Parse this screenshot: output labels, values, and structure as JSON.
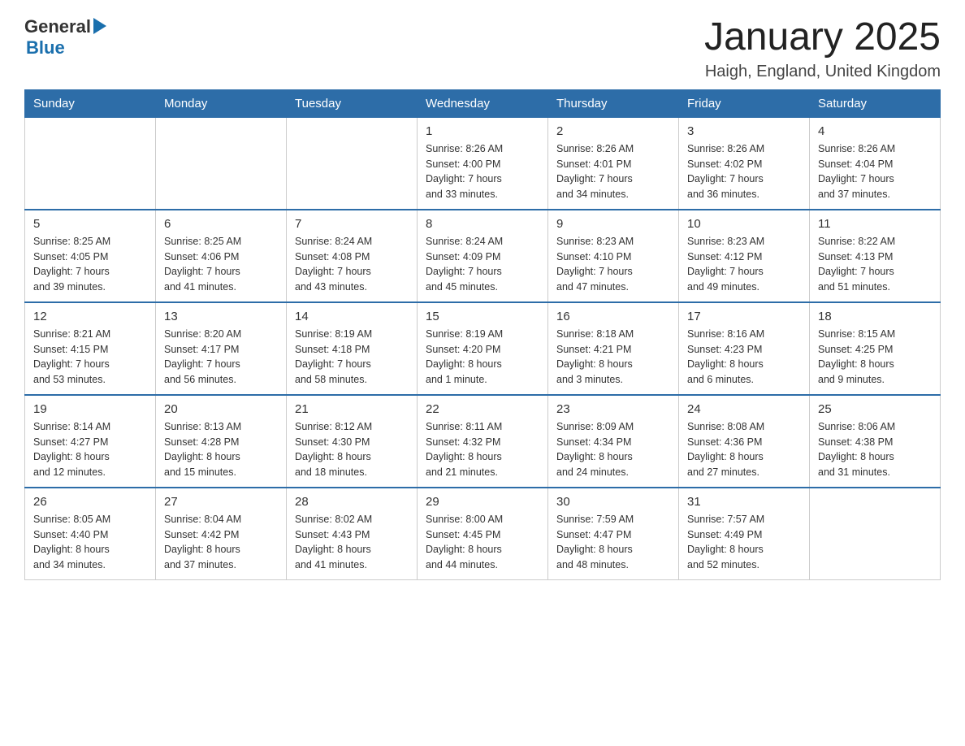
{
  "header": {
    "logo_general": "General",
    "logo_blue": "Blue",
    "month_title": "January 2025",
    "location": "Haigh, England, United Kingdom"
  },
  "days_of_week": [
    "Sunday",
    "Monday",
    "Tuesday",
    "Wednesday",
    "Thursday",
    "Friday",
    "Saturday"
  ],
  "weeks": [
    [
      {
        "day": "",
        "info": ""
      },
      {
        "day": "",
        "info": ""
      },
      {
        "day": "",
        "info": ""
      },
      {
        "day": "1",
        "info": "Sunrise: 8:26 AM\nSunset: 4:00 PM\nDaylight: 7 hours\nand 33 minutes."
      },
      {
        "day": "2",
        "info": "Sunrise: 8:26 AM\nSunset: 4:01 PM\nDaylight: 7 hours\nand 34 minutes."
      },
      {
        "day": "3",
        "info": "Sunrise: 8:26 AM\nSunset: 4:02 PM\nDaylight: 7 hours\nand 36 minutes."
      },
      {
        "day": "4",
        "info": "Sunrise: 8:26 AM\nSunset: 4:04 PM\nDaylight: 7 hours\nand 37 minutes."
      }
    ],
    [
      {
        "day": "5",
        "info": "Sunrise: 8:25 AM\nSunset: 4:05 PM\nDaylight: 7 hours\nand 39 minutes."
      },
      {
        "day": "6",
        "info": "Sunrise: 8:25 AM\nSunset: 4:06 PM\nDaylight: 7 hours\nand 41 minutes."
      },
      {
        "day": "7",
        "info": "Sunrise: 8:24 AM\nSunset: 4:08 PM\nDaylight: 7 hours\nand 43 minutes."
      },
      {
        "day": "8",
        "info": "Sunrise: 8:24 AM\nSunset: 4:09 PM\nDaylight: 7 hours\nand 45 minutes."
      },
      {
        "day": "9",
        "info": "Sunrise: 8:23 AM\nSunset: 4:10 PM\nDaylight: 7 hours\nand 47 minutes."
      },
      {
        "day": "10",
        "info": "Sunrise: 8:23 AM\nSunset: 4:12 PM\nDaylight: 7 hours\nand 49 minutes."
      },
      {
        "day": "11",
        "info": "Sunrise: 8:22 AM\nSunset: 4:13 PM\nDaylight: 7 hours\nand 51 minutes."
      }
    ],
    [
      {
        "day": "12",
        "info": "Sunrise: 8:21 AM\nSunset: 4:15 PM\nDaylight: 7 hours\nand 53 minutes."
      },
      {
        "day": "13",
        "info": "Sunrise: 8:20 AM\nSunset: 4:17 PM\nDaylight: 7 hours\nand 56 minutes."
      },
      {
        "day": "14",
        "info": "Sunrise: 8:19 AM\nSunset: 4:18 PM\nDaylight: 7 hours\nand 58 minutes."
      },
      {
        "day": "15",
        "info": "Sunrise: 8:19 AM\nSunset: 4:20 PM\nDaylight: 8 hours\nand 1 minute."
      },
      {
        "day": "16",
        "info": "Sunrise: 8:18 AM\nSunset: 4:21 PM\nDaylight: 8 hours\nand 3 minutes."
      },
      {
        "day": "17",
        "info": "Sunrise: 8:16 AM\nSunset: 4:23 PM\nDaylight: 8 hours\nand 6 minutes."
      },
      {
        "day": "18",
        "info": "Sunrise: 8:15 AM\nSunset: 4:25 PM\nDaylight: 8 hours\nand 9 minutes."
      }
    ],
    [
      {
        "day": "19",
        "info": "Sunrise: 8:14 AM\nSunset: 4:27 PM\nDaylight: 8 hours\nand 12 minutes."
      },
      {
        "day": "20",
        "info": "Sunrise: 8:13 AM\nSunset: 4:28 PM\nDaylight: 8 hours\nand 15 minutes."
      },
      {
        "day": "21",
        "info": "Sunrise: 8:12 AM\nSunset: 4:30 PM\nDaylight: 8 hours\nand 18 minutes."
      },
      {
        "day": "22",
        "info": "Sunrise: 8:11 AM\nSunset: 4:32 PM\nDaylight: 8 hours\nand 21 minutes."
      },
      {
        "day": "23",
        "info": "Sunrise: 8:09 AM\nSunset: 4:34 PM\nDaylight: 8 hours\nand 24 minutes."
      },
      {
        "day": "24",
        "info": "Sunrise: 8:08 AM\nSunset: 4:36 PM\nDaylight: 8 hours\nand 27 minutes."
      },
      {
        "day": "25",
        "info": "Sunrise: 8:06 AM\nSunset: 4:38 PM\nDaylight: 8 hours\nand 31 minutes."
      }
    ],
    [
      {
        "day": "26",
        "info": "Sunrise: 8:05 AM\nSunset: 4:40 PM\nDaylight: 8 hours\nand 34 minutes."
      },
      {
        "day": "27",
        "info": "Sunrise: 8:04 AM\nSunset: 4:42 PM\nDaylight: 8 hours\nand 37 minutes."
      },
      {
        "day": "28",
        "info": "Sunrise: 8:02 AM\nSunset: 4:43 PM\nDaylight: 8 hours\nand 41 minutes."
      },
      {
        "day": "29",
        "info": "Sunrise: 8:00 AM\nSunset: 4:45 PM\nDaylight: 8 hours\nand 44 minutes."
      },
      {
        "day": "30",
        "info": "Sunrise: 7:59 AM\nSunset: 4:47 PM\nDaylight: 8 hours\nand 48 minutes."
      },
      {
        "day": "31",
        "info": "Sunrise: 7:57 AM\nSunset: 4:49 PM\nDaylight: 8 hours\nand 52 minutes."
      },
      {
        "day": "",
        "info": ""
      }
    ]
  ]
}
